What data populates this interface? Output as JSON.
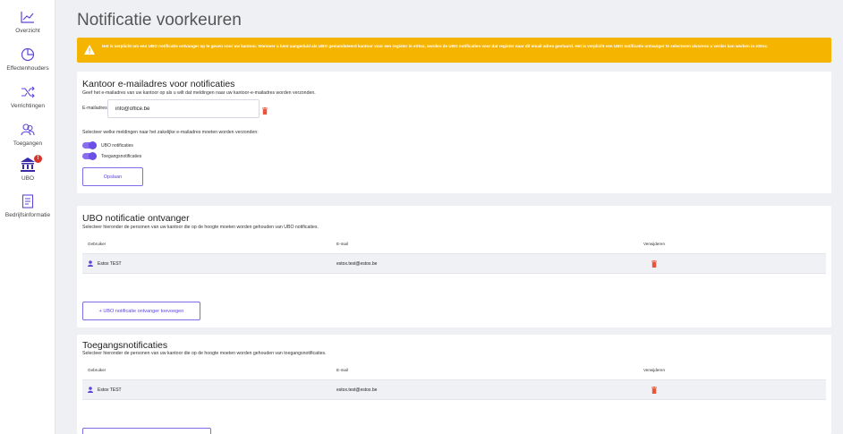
{
  "sidebar": {
    "items": [
      {
        "label": "Overzicht",
        "icon": "chart-line-icon"
      },
      {
        "label": "Effectenhouders",
        "icon": "pie-chart-icon"
      },
      {
        "label": "Verrichtingen",
        "icon": "shuffle-icon"
      },
      {
        "label": "Toegangen",
        "icon": "users-icon"
      },
      {
        "label": "UBO",
        "icon": "bank-icon",
        "badge": "!"
      },
      {
        "label": "Bedrijfsinformatie",
        "icon": "document-icon"
      }
    ]
  },
  "page": {
    "title": "Notificatie voorkeuren"
  },
  "warning": {
    "text": "Het is verplicht om een UBO notificatie ontvanger op te geven voor uw kantoor. Wanneer u bent aangeduid als UBO gemandateerd kantoor voor een register in eStox, worden de UBO notificaties voor dat register naar dit email adres gestuurd. Het is verplicht een UBO notificatie ontvanger te selecteren alvorens u verder kan werken in eStox.",
    "color": "#f4b400"
  },
  "office_emails": {
    "title": "Kantoor e-mailadres voor notificaties",
    "subtitle": "Geef het e-mailadres van uw kantoor op als u wilt dat meldingen naar uw kantoor-e-mailadres worden verzonden.",
    "email_label": "E-mailadres",
    "email_value": "info@office.be",
    "select_text": "Selecteer welke meldingen naar het zakelijke e-mailadres moeten worden verzonden:",
    "toggles": [
      {
        "label": "UBO notificaties",
        "on": true
      },
      {
        "label": "Toegangsnotificaties",
        "on": true
      }
    ],
    "save_label": "Opslaan"
  },
  "ubo_recipients": {
    "title": "UBO notificatie ontvanger",
    "subtitle": "Selecteer hieronder de personen van uw kantoor die op de hoogte moeten worden gehouden van UBO notificaties.",
    "columns": [
      "Gebruiker",
      "E-mail",
      "Verwijderen"
    ],
    "rows": [
      {
        "user": "Estox TEST",
        "email": "estox.test@estox.be"
      }
    ],
    "add_label": "+  UBO notificatie ontvanger toevoegen"
  },
  "access_notifications": {
    "title": "Toegangsnotificaties",
    "subtitle": "Selecteer hieronder de personen van uw kantoor die op de hoogte moeten worden gehouden van toegangsnotificaties.",
    "columns": [
      "Gebruiker",
      "E-mail",
      "Verwijderen"
    ],
    "rows": [
      {
        "user": "Estox TEST",
        "email": "estox.test@estox.be"
      }
    ]
  },
  "colors": {
    "accent": "#6b4fe6",
    "danger": "#e8553b",
    "warning": "#f4b400"
  }
}
